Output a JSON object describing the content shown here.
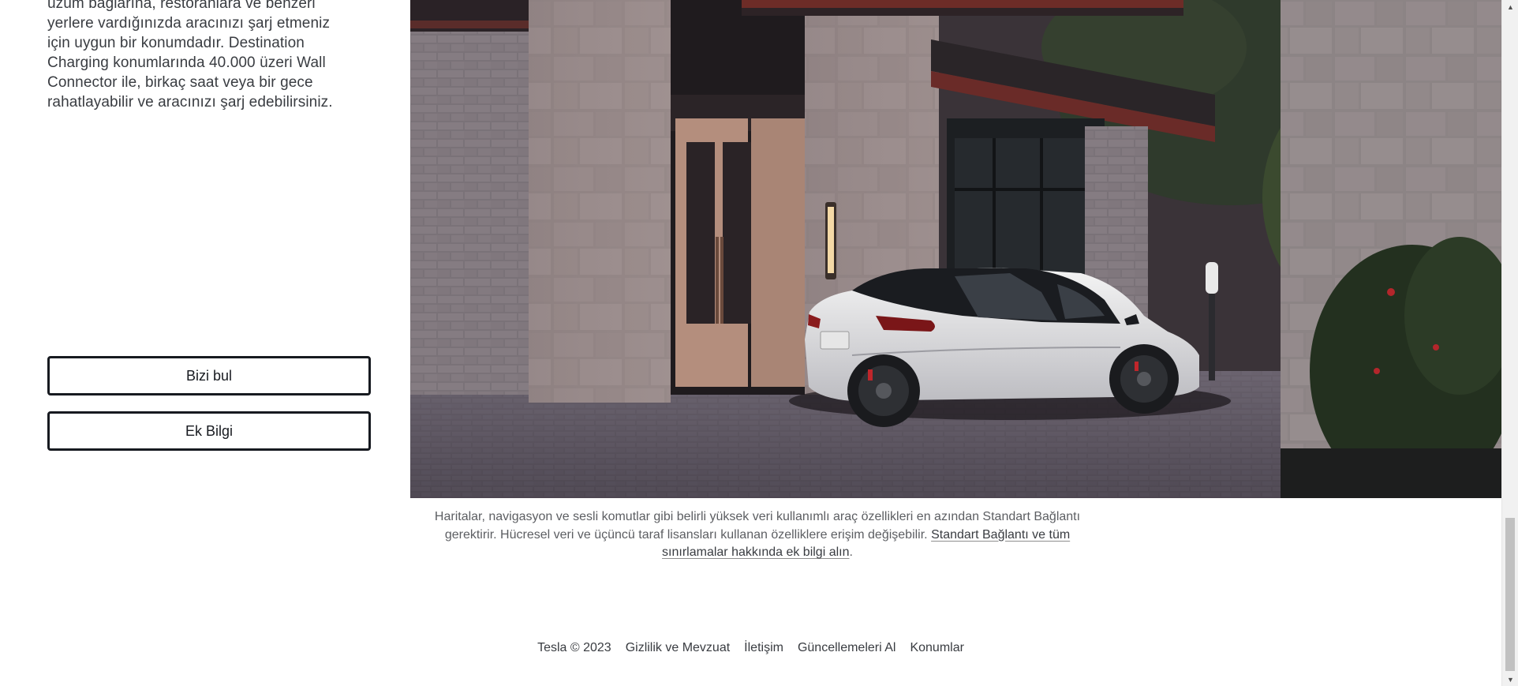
{
  "description": {
    "lines": [
      "üzüm bağlarına, restoranlara ve benzeri",
      "yerlere vardığınızda aracınızı şarj etmeniz",
      "için uygun bir konumdadır. Destination",
      "Charging konumlarında 40.000 üzeri Wall",
      "Connector ile, birkaç saat veya bir gece",
      "rahatlayabilir ve aracınızı şarj edebilirsiniz."
    ]
  },
  "buttons": {
    "find_us": "Bizi bul",
    "more_info": "Ek Bilgi"
  },
  "disclaimer": {
    "text": "Haritalar, navigasyon ve sesli komutlar gibi belirli yüksek veri kullanımlı araç özellikleri en azından Standart Bağlantı gerektirir. Hücresel veri ve üçüncü taraf lisansları kullanan özelliklere erişim değişebilir.",
    "link": "Standart Bağlantı ve tüm sınırlamalar hakkında ek bilgi alın",
    "end": "."
  },
  "footer": {
    "copyright": "Tesla © 2023",
    "links": [
      "Gizlilik ve Mevzuat",
      "İletişim",
      "Güncellemeleri Al",
      "Konumlar"
    ]
  },
  "colors": {
    "text": "#393c41",
    "button_border": "#171a20"
  }
}
